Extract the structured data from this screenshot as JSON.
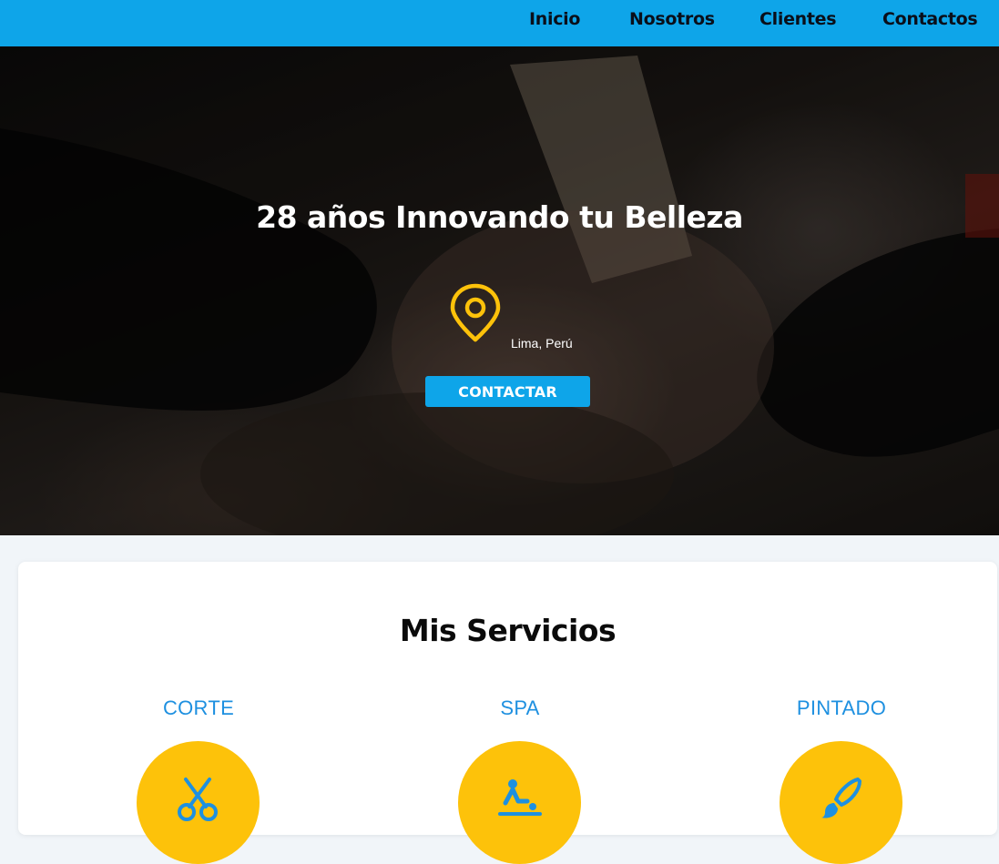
{
  "nav": {
    "items": [
      {
        "label": "Inicio"
      },
      {
        "label": "Nosotros"
      },
      {
        "label": "Clientes"
      },
      {
        "label": "Contactos"
      }
    ]
  },
  "hero": {
    "title": "28 años Innovando tu Belleza",
    "location_icon": "map-pin-icon",
    "location": "Lima, Perú",
    "button_label": "CONTACTAR"
  },
  "services": {
    "title": "Mis Servicios",
    "items": [
      {
        "name": "CORTE",
        "icon": "scissors-icon"
      },
      {
        "name": "SPA",
        "icon": "massage-icon"
      },
      {
        "name": "PINTADO",
        "icon": "paint-brush-icon"
      }
    ]
  },
  "colors": {
    "primary": "#0ea5e9",
    "accent": "#fdc20a",
    "service_text": "#1e90e0"
  }
}
